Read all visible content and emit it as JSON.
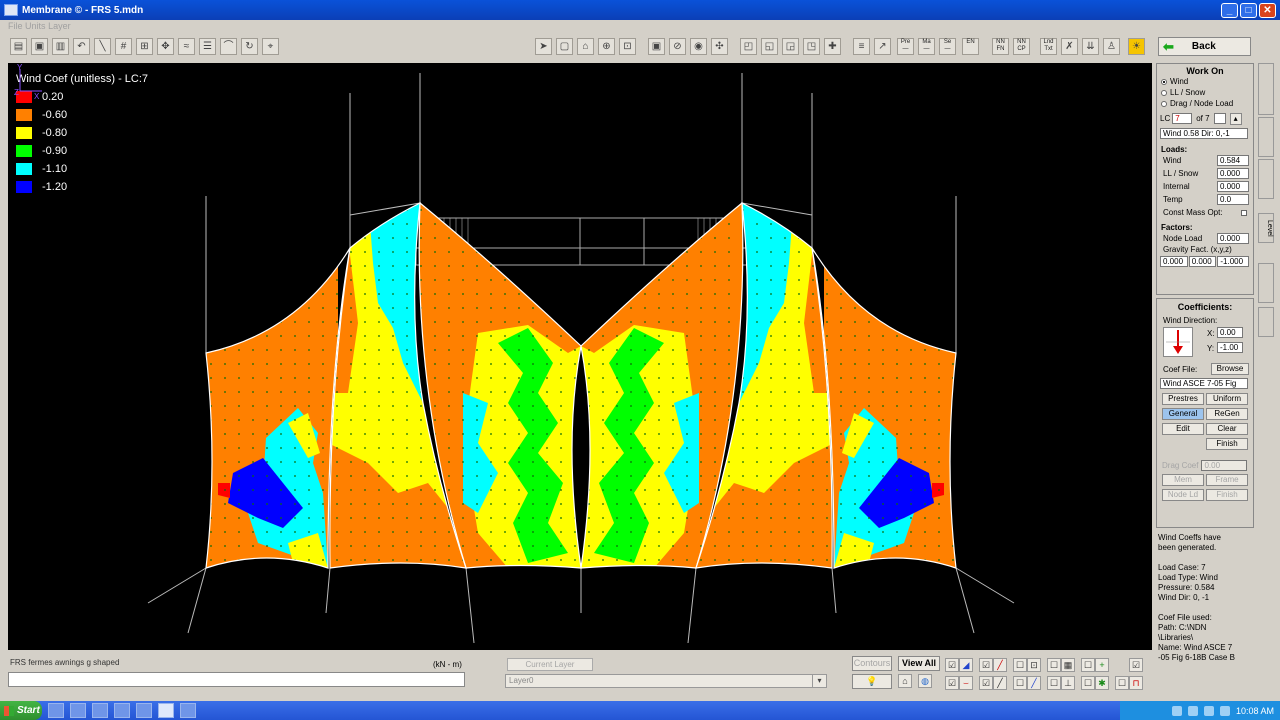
{
  "window": {
    "title": "Membrane ©  -  FRS 5.mdn"
  },
  "menubar": {
    "items": [
      "File",
      "Units",
      "Layer"
    ]
  },
  "back_button": {
    "label": "Back"
  },
  "toolbar_text_buttons": [
    {
      "top": "Pre",
      "bottom": "—"
    },
    {
      "top": "Ma",
      "bottom": "—"
    },
    {
      "top": "Se",
      "bottom": "—"
    },
    {
      "top": "EN",
      "bottom": ""
    },
    {
      "top": "NN",
      "bottom": "FN"
    },
    {
      "top": "NN",
      "bottom": "CP"
    },
    {
      "top": "Lnd",
      "bottom": "Txt"
    }
  ],
  "legend": {
    "title": "Wind Coef (unitless) - LC:7",
    "entries": [
      {
        "label": "0.20",
        "color": "#ff0000"
      },
      {
        "label": "-0.60",
        "color": "#ff8000"
      },
      {
        "label": "-0.80",
        "color": "#ffff00"
      },
      {
        "label": "-0.90",
        "color": "#00ff00"
      },
      {
        "label": "-1.10",
        "color": "#00ffff"
      },
      {
        "label": "-1.20",
        "color": "#0000ff"
      }
    ]
  },
  "axis": {
    "y": "Y",
    "z": "Z",
    "x": "X"
  },
  "work_on": {
    "title": "Work On",
    "options": [
      {
        "label": "Wind",
        "selected": true
      },
      {
        "label": "LL / Snow",
        "selected": false
      },
      {
        "label": "Drag / Node Load",
        "selected": false
      }
    ],
    "lc_label": "LC",
    "lc_value": "7",
    "lc_of": "of 7",
    "description": "Wind 0.58 Dir: 0,-1"
  },
  "loads": {
    "title": "Loads:",
    "rows": [
      {
        "label": "Wind",
        "value": "0.584"
      },
      {
        "label": "LL / Snow",
        "value": "0.000"
      },
      {
        "label": "Internal",
        "value": "0.000"
      },
      {
        "label": "Temp",
        "value": "0.0"
      }
    ],
    "const_mass": "Const Mass Opt:"
  },
  "factors": {
    "title": "Factors:",
    "node_load_label": "Node Load",
    "node_load_value": "0.000",
    "gravity_label": "Gravity Fact. (x,y,z)",
    "gravity_values": [
      "0.000",
      "0.000",
      "-1.000"
    ]
  },
  "coefficients": {
    "title": "Coefficients:",
    "wind_direction_label": "Wind Direction:",
    "x_label": "X:",
    "x_value": "0.00",
    "y_label": "Y:",
    "y_value": "-1.00",
    "coef_file_label": "Coef File:",
    "browse_label": "Browse",
    "coef_file_value": "Wind ASCE 7-05 Fig",
    "buttons": {
      "prestress": "Prestres",
      "uniform": "Uniform",
      "general": "General",
      "regen": "ReGen",
      "edit": "Edit",
      "clear": "Clear",
      "finish": "Finish"
    },
    "drag_coef_label": "Drag Coef",
    "drag_coef_value": "0.00",
    "disabled_buttons": [
      "Mem",
      "Frame",
      "Node Ld",
      "Finish"
    ]
  },
  "info": {
    "lines": [
      "Wind Coeffs have",
      "been generated.",
      "",
      "Load Case:  7",
      "Load Type:  Wind",
      "Pressure:   0.584",
      "Wind Dir:   0, -1",
      "",
      "Coef File used:",
      "Path: C:\\NDN",
      "\\Libraries\\",
      "Name: Wind ASCE 7",
      "-05 Fig 6-18B Case B"
    ]
  },
  "status": {
    "label": "FRS fermes awnings g shaped",
    "units": "(kN - m)",
    "command_value": ""
  },
  "layer": {
    "current_layer_button": "Current Layer",
    "selected": "Layer0"
  },
  "bottom_buttons": {
    "contours": "Contours",
    "view_all": "View All"
  },
  "taskbar": {
    "start": "Start",
    "time": "10:08 AM"
  },
  "chart_data": {
    "type": "heatmap",
    "title": "Wind Coef (unitless) - LC:7",
    "legend_values": [
      0.2,
      -0.6,
      -0.8,
      -0.9,
      -1.1,
      -1.2
    ],
    "legend_colors": [
      "#ff0000",
      "#ff8000",
      "#ffff00",
      "#00ff00",
      "#00ffff",
      "#0000ff"
    ]
  }
}
